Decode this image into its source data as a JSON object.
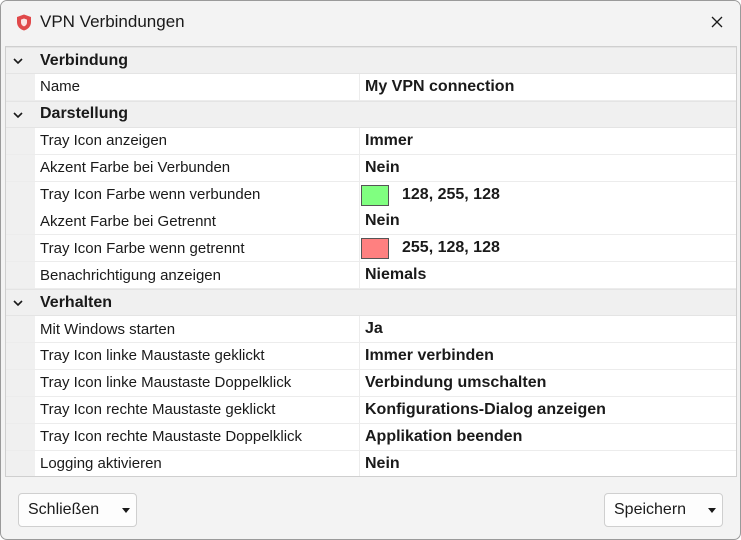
{
  "window": {
    "title": "VPN Verbindungen",
    "icon": "shield-icon",
    "close_icon": "close-icon"
  },
  "grid": {
    "categories": [
      {
        "label": "Verbindung",
        "items": [
          {
            "label": "Name",
            "value": "My VPN connection"
          }
        ]
      },
      {
        "label": "Darstellung",
        "items": [
          {
            "label": "Tray Icon anzeigen",
            "value": "Immer"
          },
          {
            "label": "Akzent Farbe bei Verbunden",
            "value": "Nein"
          },
          {
            "label": "Tray Icon Farbe wenn verbunden",
            "value": "128, 255, 128",
            "swatch": "#80ff80"
          },
          {
            "label": "Akzent Farbe bei Getrennt",
            "value": "Nein"
          },
          {
            "label": "Tray Icon Farbe wenn getrennt",
            "value": "255, 128, 128",
            "swatch": "#ff8080"
          },
          {
            "label": "Benachrichtigung anzeigen",
            "value": "Niemals"
          }
        ]
      },
      {
        "label": "Verhalten",
        "items": [
          {
            "label": "Mit Windows starten",
            "value": "Ja"
          },
          {
            "label": "Tray Icon linke Maustaste geklickt",
            "value": "Immer verbinden"
          },
          {
            "label": "Tray Icon linke Maustaste Doppelklick",
            "value": "Verbindung umschalten"
          },
          {
            "label": "Tray Icon rechte Maustaste geklickt",
            "value": "Konfigurations-Dialog anzeigen"
          },
          {
            "label": "Tray Icon rechte Maustaste Doppelklick",
            "value": "Applikation beenden"
          },
          {
            "label": "Logging aktivieren",
            "value": "Nein"
          }
        ]
      }
    ]
  },
  "footer": {
    "close_label": "Schließen",
    "save_label": "Speichern"
  },
  "colors": {
    "accent_icon": "#e0484a",
    "window_bg": "#f3f3f3",
    "grid_bg": "#ffffff"
  }
}
